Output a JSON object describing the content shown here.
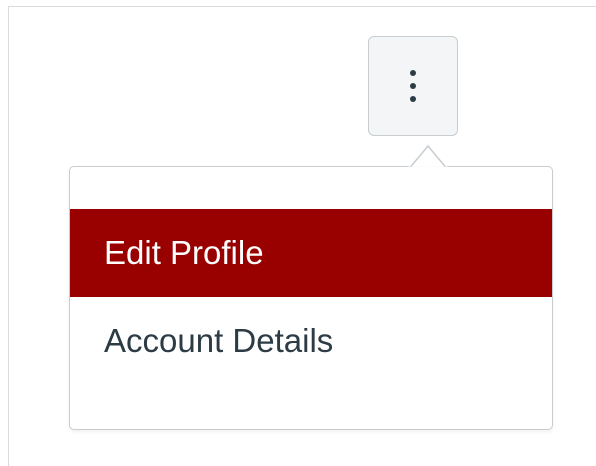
{
  "kebab_button": {
    "icon": "vertical-ellipsis-icon"
  },
  "menu": {
    "items": [
      {
        "label": "Edit Profile",
        "active": true
      },
      {
        "label": "Account Details",
        "active": false
      }
    ]
  },
  "colors": {
    "accent": "#990000",
    "text": "#2d3b45",
    "button_bg": "#f4f5f6",
    "border": "#c7cdd1"
  }
}
